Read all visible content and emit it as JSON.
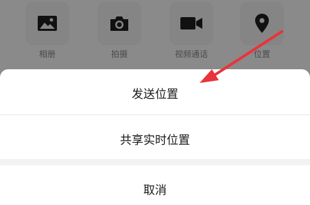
{
  "attach_panel": {
    "items": [
      {
        "label": "相册",
        "icon": "image-icon"
      },
      {
        "label": "拍摄",
        "icon": "camera-icon"
      },
      {
        "label": "视频通话",
        "icon": "video-camera-icon"
      },
      {
        "label": "位置",
        "icon": "location-pin-icon"
      }
    ]
  },
  "action_sheet": {
    "send_location": "发送位置",
    "share_realtime_location": "共享实时位置",
    "cancel": "取消"
  },
  "colors": {
    "overlay": "#8a8a8a",
    "annotation_arrow": "#e8343a",
    "sheet_background": "#ffffff"
  }
}
